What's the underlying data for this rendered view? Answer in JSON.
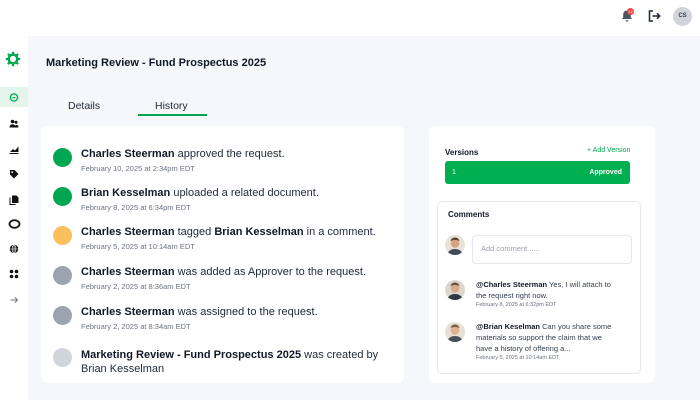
{
  "header": {
    "notification_count": "12",
    "user_initials": "CS",
    "icons": [
      "bell-icon",
      "logout-icon"
    ]
  },
  "sidebar": {
    "items": [
      "home-icon",
      "people-icon",
      "chart-icon",
      "tag-icon",
      "document-icon",
      "ring-icon",
      "globe-icon",
      "apps-icon",
      "arrow-right-icon"
    ],
    "active_index": 0
  },
  "page": {
    "title": "Marketing Review - Fund Prospectus 2025"
  },
  "tabs": [
    {
      "label": "Details",
      "active": false
    },
    {
      "label": "History",
      "active": true
    }
  ],
  "history": [
    {
      "actor": "Charles Steerman",
      "action": " approved the request.",
      "date": "February 10, 2025 at 2:34pm EDT",
      "color": "#00a650"
    },
    {
      "actor": "Brian Kesselman",
      "action": " uploaded a related document.",
      "date": "February 8, 2025 at 6:34pm EDT",
      "color": "#00a650"
    },
    {
      "actor": "Charles Steerman",
      "action": " tagged ",
      "target": "Brian Kesselman",
      "suffix": " in a comment.",
      "date": "February 5, 2025 at 10:14am EDT",
      "color": "#fbbf5e"
    },
    {
      "actor": "Charles Steerman",
      "action": " was added as Approver to the request.",
      "date": "February 2, 2025 at 8:36am EDT",
      "color": "#9ca3af"
    },
    {
      "actor": "Charles Steerman",
      "action": " was assigned to the request.",
      "date": "February 2, 2025 at 8:34am EDT",
      "color": "#9ca3af"
    },
    {
      "actor": "Marketing Review - Fund Prospectus 2025",
      "action": " was created by Brian Kesselman",
      "date": "",
      "color": "#d1d5db"
    }
  ],
  "versions": {
    "title": "Versions",
    "add_label": "+ Add Version",
    "items": [
      {
        "number": "1",
        "status": "Approved"
      }
    ]
  },
  "comments": {
    "title": "Comments",
    "placeholder": "Add comment......",
    "items": [
      {
        "author": "@Charles Steerman",
        "text": " Yes, I will attach to the request right now.",
        "date": "February 8, 2025 at 6:32pm EDT"
      },
      {
        "author": "@Brian Keselman",
        "text": " Can you share some materials so support the claim that we have a history of offering a...",
        "date": "February 5, 2025 at 10:14am EDT"
      }
    ]
  },
  "colors": {
    "accent": "#00a650",
    "pending": "#fbbf5e",
    "inactive": "#9ca3af"
  }
}
